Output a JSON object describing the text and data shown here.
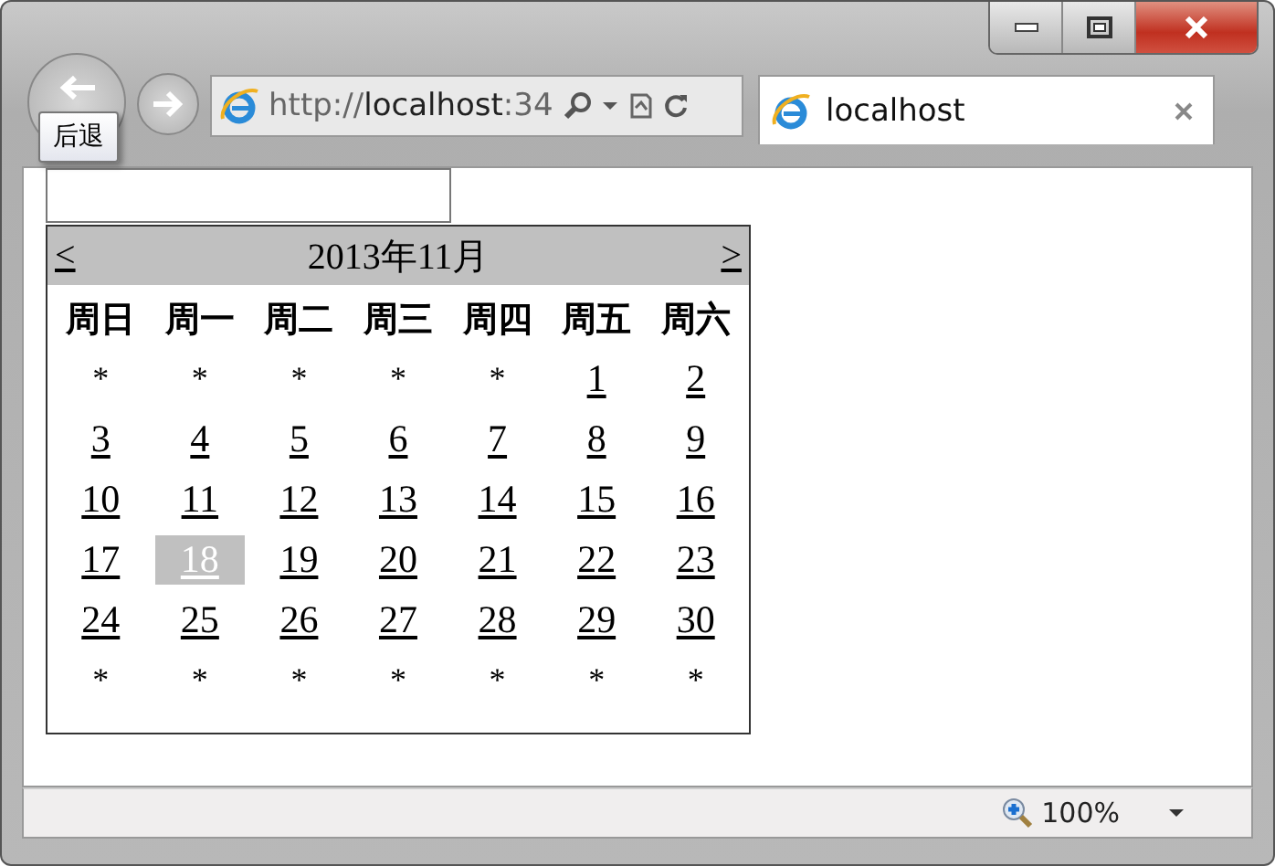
{
  "browser": {
    "back_tooltip": "后退",
    "address": {
      "scheme": "http://",
      "host": "localhost",
      "rest": ":34"
    },
    "tab": {
      "title": "localhost"
    },
    "zoom": "100%"
  },
  "calendar": {
    "prev": "<",
    "next": ">",
    "title": "2013年11月",
    "weekdays": [
      "周日",
      "周一",
      "周二",
      "周三",
      "周四",
      "周五",
      "周六"
    ],
    "weeks": [
      [
        {
          "kind": "blank",
          "text": "*"
        },
        {
          "kind": "blank",
          "text": "*"
        },
        {
          "kind": "blank",
          "text": "*"
        },
        {
          "kind": "blank",
          "text": "*"
        },
        {
          "kind": "blank",
          "text": "*"
        },
        {
          "kind": "date",
          "text": "1",
          "selected": false
        },
        {
          "kind": "date",
          "text": "2",
          "selected": false
        }
      ],
      [
        {
          "kind": "date",
          "text": "3",
          "selected": false
        },
        {
          "kind": "date",
          "text": "4",
          "selected": false
        },
        {
          "kind": "date",
          "text": "5",
          "selected": false
        },
        {
          "kind": "date",
          "text": "6",
          "selected": false
        },
        {
          "kind": "date",
          "text": "7",
          "selected": false
        },
        {
          "kind": "date",
          "text": "8",
          "selected": false
        },
        {
          "kind": "date",
          "text": "9",
          "selected": false
        }
      ],
      [
        {
          "kind": "date",
          "text": "10",
          "selected": false
        },
        {
          "kind": "date",
          "text": "11",
          "selected": false
        },
        {
          "kind": "date",
          "text": "12",
          "selected": false
        },
        {
          "kind": "date",
          "text": "13",
          "selected": false
        },
        {
          "kind": "date",
          "text": "14",
          "selected": false
        },
        {
          "kind": "date",
          "text": "15",
          "selected": false
        },
        {
          "kind": "date",
          "text": "16",
          "selected": false
        }
      ],
      [
        {
          "kind": "date",
          "text": "17",
          "selected": false
        },
        {
          "kind": "date",
          "text": "18",
          "selected": true
        },
        {
          "kind": "date",
          "text": "19",
          "selected": false
        },
        {
          "kind": "date",
          "text": "20",
          "selected": false
        },
        {
          "kind": "date",
          "text": "21",
          "selected": false
        },
        {
          "kind": "date",
          "text": "22",
          "selected": false
        },
        {
          "kind": "date",
          "text": "23",
          "selected": false
        }
      ],
      [
        {
          "kind": "date",
          "text": "24",
          "selected": false
        },
        {
          "kind": "date",
          "text": "25",
          "selected": false
        },
        {
          "kind": "date",
          "text": "26",
          "selected": false
        },
        {
          "kind": "date",
          "text": "27",
          "selected": false
        },
        {
          "kind": "date",
          "text": "28",
          "selected": false
        },
        {
          "kind": "date",
          "text": "29",
          "selected": false
        },
        {
          "kind": "date",
          "text": "30",
          "selected": false
        }
      ],
      [
        {
          "kind": "blank",
          "text": "*"
        },
        {
          "kind": "blank",
          "text": "*"
        },
        {
          "kind": "blank",
          "text": "*"
        },
        {
          "kind": "blank",
          "text": "*"
        },
        {
          "kind": "blank",
          "text": "*"
        },
        {
          "kind": "blank",
          "text": "*"
        },
        {
          "kind": "blank",
          "text": "*"
        }
      ]
    ]
  }
}
